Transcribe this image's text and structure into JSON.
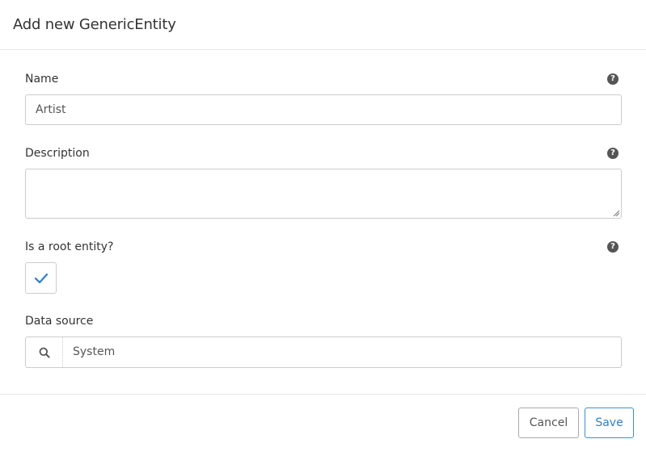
{
  "modal": {
    "title": "Add new GenericEntity"
  },
  "fields": {
    "name": {
      "label": "Name",
      "value": "Artist"
    },
    "description": {
      "label": "Description",
      "value": ""
    },
    "is_root": {
      "label": "Is a root entity?",
      "checked": true
    },
    "data_source": {
      "label": "Data source",
      "value": "System"
    }
  },
  "help_glyph": "?",
  "icons": {
    "help": "question-circle-icon",
    "check": "checkmark-icon",
    "search": "search-icon",
    "resize": "resize-grip-icon"
  },
  "colors": {
    "accent": "#2b7fd4",
    "help_icon": "#555555",
    "border": "#cccccc"
  },
  "footer": {
    "cancel_label": "Cancel",
    "save_label": "Save"
  }
}
